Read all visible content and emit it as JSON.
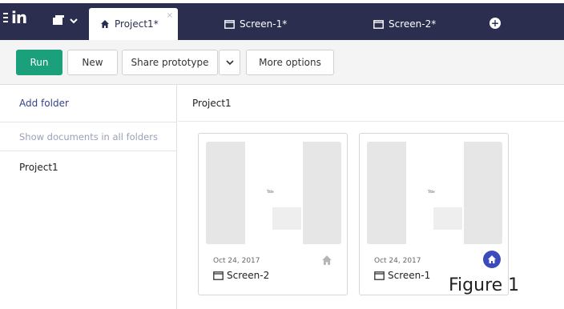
{
  "app": {
    "logo_text": "in"
  },
  "tabs": [
    {
      "label": "Project1*",
      "icon": "home-icon",
      "active": true
    },
    {
      "label": "Screen-1*",
      "icon": "screen-icon",
      "active": false
    },
    {
      "label": "Screen-2*",
      "icon": "screen-icon",
      "active": false
    }
  ],
  "tab_close_glyph": "×",
  "add_tab_glyph": "+",
  "toolbar": {
    "run_label": "Run",
    "new_label": "New",
    "share_label": "Share prototype",
    "caret_glyph": "⌄",
    "more_label": "More options"
  },
  "sidebar": {
    "add_folder": "Add folder",
    "show_all": "Show documents in all folders",
    "folders": [
      "Project1"
    ]
  },
  "main": {
    "title": "Project1",
    "cards": [
      {
        "date": "Oct 24, 2017",
        "name": "Screen-2",
        "thumb_title": "Title",
        "is_home": false
      },
      {
        "date": "Oct 24, 2017",
        "name": "Screen-1",
        "thumb_title": "Title",
        "is_home": true
      }
    ]
  },
  "caption": "Figure 1",
  "colors": {
    "topbar": "#2b2e4f",
    "run": "#1aa07a",
    "link": "#35428a",
    "home_badge": "#3b4bbb"
  }
}
